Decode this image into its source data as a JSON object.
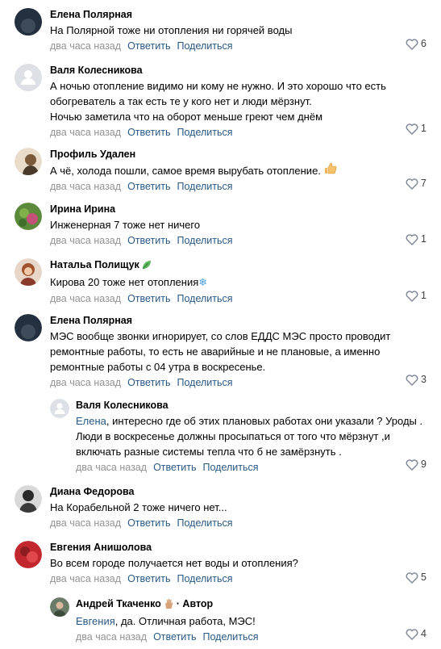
{
  "footer_time": "два часа назад",
  "reply_label": "Ответить",
  "share_label": "Поделиться",
  "comments": [
    {
      "name": "Елена Полярная",
      "text": "На Полярной тоже ни отопления ни горячей воды",
      "likes": "6"
    },
    {
      "name": "Валя Колесникова",
      "text_lines": [
        "А ночью отопление видимо ни кому не нужно. И это хорошо что есть",
        "обогреватель а так есть те у кого нет и люди мёрзнут.",
        "Ночью заметила что на оборот меньше греют чем днём"
      ],
      "likes": "1"
    },
    {
      "name": "Профиль Удален",
      "text": "А чё, холода пошли, самое время вырубать отопление.",
      "likes": "7"
    },
    {
      "name": "Ирина Ирина",
      "text": "Инженерная 7 тоже нет ничего",
      "likes": "1"
    },
    {
      "name": "Натальа Полищук",
      "text": "Кирова 20 тоже нет отопления",
      "likes": "1"
    },
    {
      "name": "Елена Полярная",
      "text_lines": [
        "МЭС вообще звонки игнорирует, со слов ЕДДС МЭС просто проводит",
        "ремонтные работы, то есть не аварийные и не плановые, а именно",
        "ремонтные работы с 04 утра в воскресенье."
      ],
      "likes": "3"
    },
    {
      "name": "Валя Колесникова",
      "ref": "Елена",
      "text_lines": [
        ", интересно где об этих плановых работах они указали ? Уроды .",
        "Люди в воскресенье должны просыпаться от того что мёрзнут ,и",
        "включать разные системы тепла что б не замёрзнуть ."
      ],
      "likes": "9"
    },
    {
      "name": "Диана Федорова",
      "text": "На Корабельной 2 тоже ничего нет...",
      "likes": ""
    },
    {
      "name": "Евгения Анишолова",
      "text": "Во всем городе получается нет воды и отопления?",
      "likes": "5"
    },
    {
      "name": "Андрей Ткаченко",
      "author_tag": "· Автор",
      "ref": "Евгения",
      "text": ", да. Отличная работа, МЭС!",
      "likes": "4"
    }
  ],
  "colors": {
    "link": "#2a5885",
    "meta": "#939393",
    "background": "#ffffff"
  }
}
